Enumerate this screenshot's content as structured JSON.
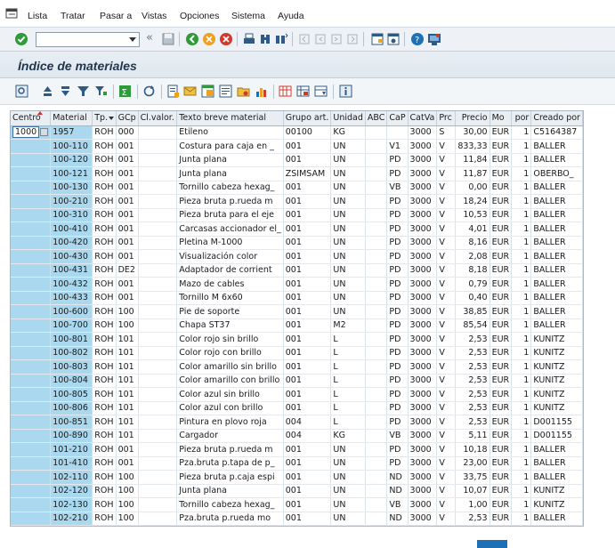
{
  "menu": [
    {
      "label": "Lista"
    },
    {
      "label": "Tratar"
    },
    {
      "label": "Pasar a"
    },
    {
      "label": "Vistas"
    },
    {
      "label": "Opciones"
    },
    {
      "label": "Sistema"
    },
    {
      "label": "Ayuda"
    }
  ],
  "command_field": {
    "value": ""
  },
  "page_title": "Índice de materiales",
  "columns": [
    "Centro",
    "Material",
    "Tp.",
    "GCp",
    "Cl.valor.",
    "Texto breve material",
    "Grupo art.",
    "Unidad",
    "ABC",
    "CaP",
    "CatVa",
    "Prc",
    "Precio",
    "Mo",
    "por",
    "Creado por"
  ],
  "focused_cell": "1000",
  "rows": [
    [
      "",
      "1957",
      "ROH",
      "000",
      "",
      "Etileno",
      "00100",
      "KG",
      "",
      "",
      "3000",
      "S",
      "30,00",
      "EUR",
      "1",
      "C5164387"
    ],
    [
      "",
      "100-110",
      "ROH",
      "001",
      "",
      "Costura para caja en _",
      "001",
      "UN",
      "",
      "V1",
      "3000",
      "V",
      "833,33",
      "EUR",
      "1",
      "BALLER"
    ],
    [
      "",
      "100-120",
      "ROH",
      "001",
      "",
      "Junta plana",
      "001",
      "UN",
      "",
      "PD",
      "3000",
      "V",
      "11,84",
      "EUR",
      "1",
      "BALLER"
    ],
    [
      "",
      "100-121",
      "ROH",
      "001",
      "",
      "Junta plana",
      "ZSIMSAM",
      "UN",
      "",
      "PD",
      "3000",
      "V",
      "11,87",
      "EUR",
      "1",
      "OBERBO_"
    ],
    [
      "",
      "100-130",
      "ROH",
      "001",
      "",
      "Tornillo cabeza hexag_",
      "001",
      "UN",
      "",
      "VB",
      "3000",
      "V",
      "0,00",
      "EUR",
      "1",
      "BALLER"
    ],
    [
      "",
      "100-210",
      "ROH",
      "001",
      "",
      "Pieza bruta p.rueda m",
      "001",
      "UN",
      "",
      "PD",
      "3000",
      "V",
      "18,24",
      "EUR",
      "1",
      "BALLER"
    ],
    [
      "",
      "100-310",
      "ROH",
      "001",
      "",
      "Pieza bruta para el eje",
      "001",
      "UN",
      "",
      "PD",
      "3000",
      "V",
      "10,53",
      "EUR",
      "1",
      "BALLER"
    ],
    [
      "",
      "100-410",
      "ROH",
      "001",
      "",
      "Carcasas accionador el_",
      "001",
      "UN",
      "",
      "PD",
      "3000",
      "V",
      "4,01",
      "EUR",
      "1",
      "BALLER"
    ],
    [
      "",
      "100-420",
      "ROH",
      "001",
      "",
      "Pletina M-1000",
      "001",
      "UN",
      "",
      "PD",
      "3000",
      "V",
      "8,16",
      "EUR",
      "1",
      "BALLER"
    ],
    [
      "",
      "100-430",
      "ROH",
      "001",
      "",
      "Visualización color",
      "001",
      "UN",
      "",
      "PD",
      "3000",
      "V",
      "2,08",
      "EUR",
      "1",
      "BALLER"
    ],
    [
      "",
      "100-431",
      "ROH",
      "DE2",
      "",
      "Adaptador de corrient",
      "001",
      "UN",
      "",
      "PD",
      "3000",
      "V",
      "8,18",
      "EUR",
      "1",
      "BALLER"
    ],
    [
      "",
      "100-432",
      "ROH",
      "001",
      "",
      "Mazo de cables",
      "001",
      "UN",
      "",
      "PD",
      "3000",
      "V",
      "0,79",
      "EUR",
      "1",
      "BALLER"
    ],
    [
      "",
      "100-433",
      "ROH",
      "001",
      "",
      "Tornillo M 6x60",
      "001",
      "UN",
      "",
      "PD",
      "3000",
      "V",
      "0,40",
      "EUR",
      "1",
      "BALLER"
    ],
    [
      "",
      "100-600",
      "ROH",
      "100",
      "",
      "Pie de soporte",
      "001",
      "UN",
      "",
      "PD",
      "3000",
      "V",
      "38,85",
      "EUR",
      "1",
      "BALLER"
    ],
    [
      "",
      "100-700",
      "ROH",
      "100",
      "",
      "Chapa ST37",
      "001",
      "M2",
      "",
      "PD",
      "3000",
      "V",
      "85,54",
      "EUR",
      "1",
      "BALLER"
    ],
    [
      "",
      "100-801",
      "ROH",
      "101",
      "",
      "Color rojo sin brillo",
      "001",
      "L",
      "",
      "PD",
      "3000",
      "V",
      "2,53",
      "EUR",
      "1",
      "KUNITZ"
    ],
    [
      "",
      "100-802",
      "ROH",
      "101",
      "",
      "Color rojo con brillo",
      "001",
      "L",
      "",
      "PD",
      "3000",
      "V",
      "2,53",
      "EUR",
      "1",
      "KUNITZ"
    ],
    [
      "",
      "100-803",
      "ROH",
      "101",
      "",
      "Color amarillo sin brillo",
      "001",
      "L",
      "",
      "PD",
      "3000",
      "V",
      "2,53",
      "EUR",
      "1",
      "KUNITZ"
    ],
    [
      "",
      "100-804",
      "ROH",
      "101",
      "",
      "Color amarillo con brillo",
      "001",
      "L",
      "",
      "PD",
      "3000",
      "V",
      "2,53",
      "EUR",
      "1",
      "KUNITZ"
    ],
    [
      "",
      "100-805",
      "ROH",
      "101",
      "",
      "Color azul sin brillo",
      "001",
      "L",
      "",
      "PD",
      "3000",
      "V",
      "2,53",
      "EUR",
      "1",
      "KUNITZ"
    ],
    [
      "",
      "100-806",
      "ROH",
      "101",
      "",
      "Color azul con brillo",
      "001",
      "L",
      "",
      "PD",
      "3000",
      "V",
      "2,53",
      "EUR",
      "1",
      "KUNITZ"
    ],
    [
      "",
      "100-851",
      "ROH",
      "101",
      "",
      "Pintura en plovo roja",
      "004",
      "L",
      "",
      "PD",
      "3000",
      "V",
      "2,53",
      "EUR",
      "1",
      "D001155"
    ],
    [
      "",
      "100-890",
      "ROH",
      "101",
      "",
      "Cargador",
      "004",
      "KG",
      "",
      "VB",
      "3000",
      "V",
      "5,11",
      "EUR",
      "1",
      "D001155"
    ],
    [
      "",
      "101-210",
      "ROH",
      "001",
      "",
      "Pieza bruta p.rueda m",
      "001",
      "UN",
      "",
      "PD",
      "3000",
      "V",
      "10,18",
      "EUR",
      "1",
      "BALLER"
    ],
    [
      "",
      "101-410",
      "ROH",
      "001",
      "",
      "Pza.bruta p.tapa de p_",
      "001",
      "UN",
      "",
      "PD",
      "3000",
      "V",
      "23,00",
      "EUR",
      "1",
      "BALLER"
    ],
    [
      "",
      "102-110",
      "ROH",
      "100",
      "",
      "Pieza bruta p.caja espi",
      "001",
      "UN",
      "",
      "ND",
      "3000",
      "V",
      "33,75",
      "EUR",
      "1",
      "BALLER"
    ],
    [
      "",
      "102-120",
      "ROH",
      "100",
      "",
      "Junta plana",
      "001",
      "UN",
      "",
      "ND",
      "3000",
      "V",
      "10,07",
      "EUR",
      "1",
      "KUNITZ"
    ],
    [
      "",
      "102-130",
      "ROH",
      "100",
      "",
      "Tornillo cabeza hexag_",
      "001",
      "UN",
      "",
      "VB",
      "3000",
      "V",
      "1,00",
      "EUR",
      "1",
      "KUNITZ"
    ],
    [
      "",
      "102-210",
      "ROH",
      "100",
      "",
      "Pza.bruta p.rueda mo",
      "001",
      "UN",
      "",
      "ND",
      "3000",
      "V",
      "2,53",
      "EUR",
      "1",
      "BALLER"
    ]
  ]
}
